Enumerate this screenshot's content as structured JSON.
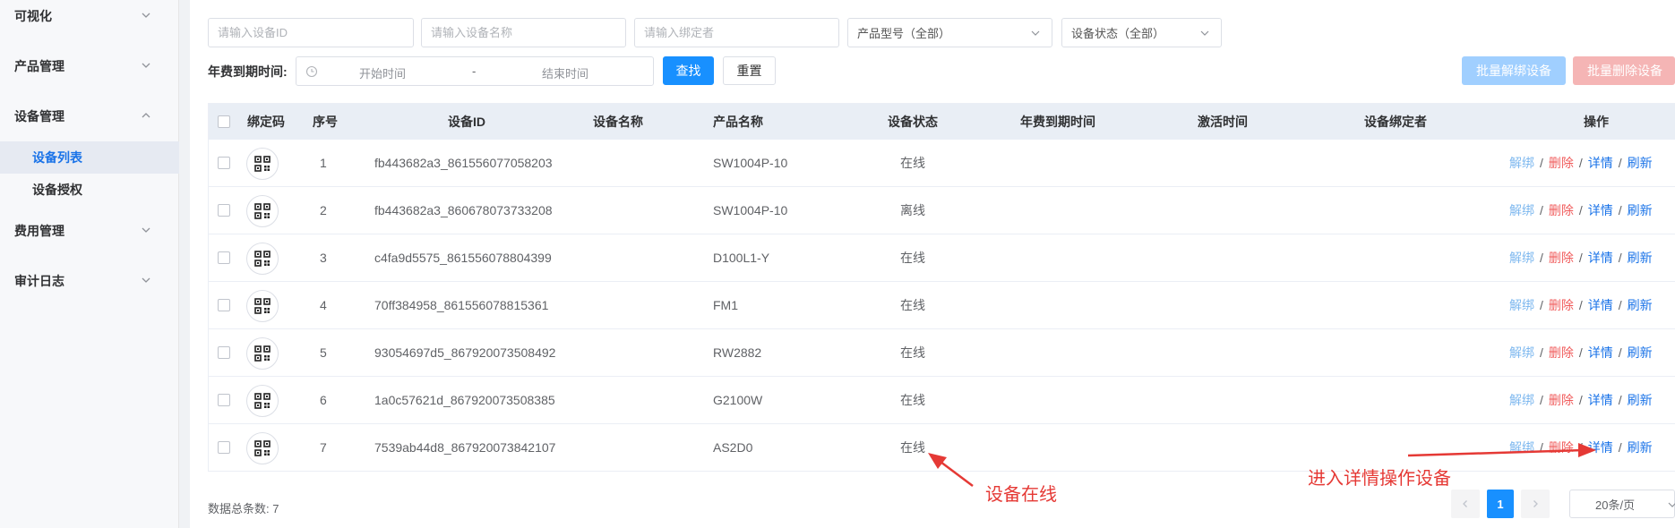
{
  "sidebar": {
    "items": [
      {
        "label": "可视化"
      },
      {
        "label": "产品管理"
      },
      {
        "label": "设备管理"
      },
      {
        "label": "费用管理"
      },
      {
        "label": "审计日志"
      }
    ],
    "device_sub": [
      {
        "label": "设备列表",
        "active": true
      },
      {
        "label": "设备授权",
        "active": false
      }
    ]
  },
  "filters": {
    "device_id_placeholder": "请输入设备ID",
    "device_name_placeholder": "请输入设备名称",
    "binder_placeholder": "请输入绑定者",
    "product_model": "产品型号（全部）",
    "device_status": "设备状态（全部）",
    "expiry_label": "年费到期时间:",
    "start_placeholder": "开始时间",
    "range_sep": "-",
    "end_placeholder": "结束时间",
    "search_label": "查找",
    "reset_label": "重置",
    "batch_unbind_label": "批量解绑设备",
    "batch_delete_label": "批量删除设备"
  },
  "table": {
    "headers": {
      "bind_code": "绑定码",
      "index": "序号",
      "device_id": "设备ID",
      "device_name": "设备名称",
      "product_name": "产品名称",
      "status": "设备状态",
      "expiry": "年费到期时间",
      "activation": "激活时间",
      "binder": "设备绑定者",
      "actions": "操作"
    },
    "rows": [
      {
        "index": "1",
        "device_id": "fb443682a3_861556077058203",
        "device_name": "",
        "product_name": "SW1004P-10",
        "status": "在线"
      },
      {
        "index": "2",
        "device_id": "fb443682a3_860678073733208",
        "device_name": "",
        "product_name": "SW1004P-10",
        "status": "离线"
      },
      {
        "index": "3",
        "device_id": "c4fa9d5575_861556078804399",
        "device_name": "",
        "product_name": "D100L1-Y",
        "status": "在线"
      },
      {
        "index": "4",
        "device_id": "70ff384958_861556078815361",
        "device_name": "",
        "product_name": "FM1",
        "status": "在线"
      },
      {
        "index": "5",
        "device_id": "93054697d5_867920073508492",
        "device_name": "",
        "product_name": "RW2882",
        "status": "在线"
      },
      {
        "index": "6",
        "device_id": "1a0c57621d_867920073508385",
        "device_name": "",
        "product_name": "G2100W",
        "status": "在线"
      },
      {
        "index": "7",
        "device_id": "7539ab44d8_867920073842107",
        "device_name": "",
        "product_name": "AS2D0",
        "status": "在线"
      }
    ],
    "actions": {
      "unbind": "解绑",
      "delete": "删除",
      "detail": "详情",
      "refresh": "刷新",
      "separator": "/"
    }
  },
  "footer": {
    "total_label": "数据总条数: 7",
    "current_page": "1",
    "page_size": "20条/页"
  },
  "annotations": {
    "online": "设备在线",
    "detail": "进入详情操作设备"
  },
  "colors": {
    "primary": "#1890ff",
    "danger": "#f05b5b",
    "annotation": "#e53935"
  }
}
